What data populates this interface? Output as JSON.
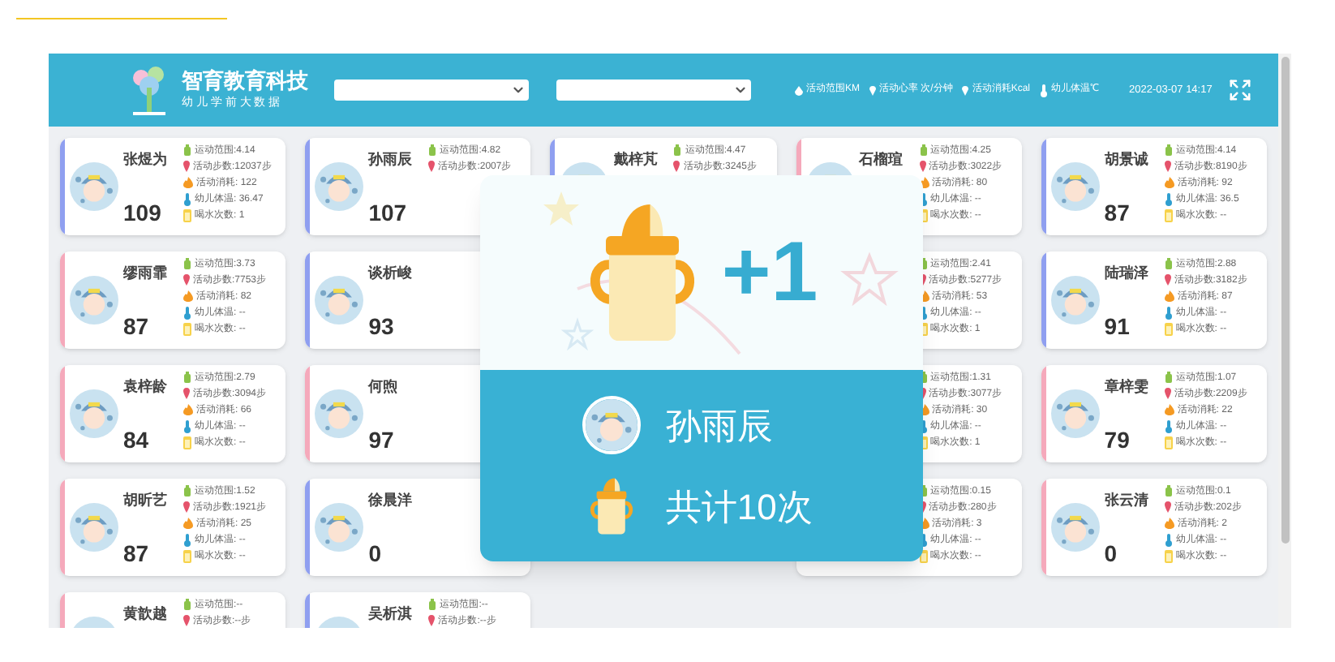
{
  "header": {
    "title": "智育教育科技",
    "subtitle": "幼 儿 学 前 大 数 据",
    "selects": [
      {
        "kind": "select"
      },
      {
        "kind": "select"
      }
    ],
    "legend": [
      {
        "kind": "drop",
        "text": "活动范围KM"
      },
      {
        "kind": "pin",
        "text": "活动心率 次/分钟"
      },
      {
        "kind": "pin",
        "text": "活动消耗Kcal"
      },
      {
        "kind": "thermo",
        "text": "幼儿体温℃"
      }
    ],
    "datetime": "2022-03-07 14:17"
  },
  "cards": [
    {
      "name": "张煜为",
      "score": "109",
      "color": "#8f9ff0",
      "stats": [
        "运动范围:4.14",
        "活动步数:12037步",
        "活动消耗: 122",
        "幼儿体温: 36.47",
        "喝水次数: 1"
      ]
    },
    {
      "name": "孙雨辰",
      "score": "107",
      "color": "#8f9ff0",
      "stats": [
        "运动范围:4.82",
        "活动步数:2007步"
      ]
    },
    {
      "name": "戴梓芃",
      "color": "#8f9ff0",
      "stats": [
        "运动范围:4.47",
        "活动步数:3245步"
      ]
    },
    {
      "name": "石榴瑄",
      "color": "#f5a9bb",
      "stats": [
        "运动范围:4.25",
        "活动步数:3022步",
        "活动消耗: 80",
        "幼儿体温: --",
        "喝水次数: --"
      ]
    },
    {
      "name": "胡景诚",
      "score": "87",
      "color": "#8f9ff0",
      "stats": [
        "运动范围:4.14",
        "活动步数:8190步",
        "活动消耗: 92",
        "幼儿体温: 36.5",
        "喝水次数: --"
      ]
    },
    {
      "name": "缪雨霏",
      "score": "87",
      "color": "#f5a9bb",
      "stats": [
        "运动范围:3.73",
        "活动步数:7753步",
        "活动消耗: 82",
        "幼儿体温: --",
        "喝水次数: --"
      ]
    },
    {
      "name": "谈析峻",
      "score": "93",
      "color": "#8f9ff0"
    },
    {
      "stats": [
        "运动范围:2.41",
        "活动步数:5277步",
        "活动消耗: 53",
        "幼儿体温: --",
        "喝水次数: 1"
      ]
    },
    {
      "name": "陆瑞泽",
      "score": "91",
      "color": "#8f9ff0",
      "stats": [
        "运动范围:2.88",
        "活动步数:3182步",
        "活动消耗: 87",
        "幼儿体温: --",
        "喝水次数: --"
      ]
    },
    {
      "name": "袁梓龄",
      "score": "84",
      "color": "#f5a9bb",
      "stats": [
        "运动范围:2.79",
        "活动步数:3094步",
        "活动消耗: 66",
        "幼儿体温: --",
        "喝水次数: --"
      ]
    },
    {
      "name": "何煦",
      "score": "97",
      "color": "#f5a9bb"
    },
    {
      "stats": [
        "运动范围:1.31",
        "活动步数:3077步",
        "活动消耗: 30",
        "幼儿体温: --",
        "喝水次数: 1"
      ]
    },
    {
      "name": "章梓雯",
      "score": "79",
      "color": "#f5a9bb",
      "stats": [
        "运动范围:1.07",
        "活动步数:2209步",
        "活动消耗: 22",
        "幼儿体温: --",
        "喝水次数: --"
      ]
    },
    {
      "name": "胡昕艺",
      "score": "87",
      "color": "#f5a9bb",
      "stats": [
        "运动范围:1.52",
        "活动步数:1921步",
        "活动消耗: 25",
        "幼儿体温: --",
        "喝水次数: --"
      ]
    },
    {
      "name": "徐晨洋",
      "score": "0",
      "color": "#8f9ff0"
    },
    {
      "stats": [
        "运动范围:0.15",
        "活动步数:280步",
        "活动消耗: 3",
        "幼儿体温: --",
        "喝水次数: --"
      ]
    },
    {
      "name": "张云清",
      "score": "0",
      "color": "#f5a9bb",
      "stats": [
        "运动范围:0.1",
        "活动步数:202步",
        "活动消耗: 2",
        "幼儿体温: --",
        "喝水次数: --"
      ]
    },
    {
      "name": "黄歆越",
      "color": "#f5a9bb",
      "stats": [
        "运动范围:--",
        "活动步数:--步"
      ]
    },
    {
      "name": "吴析淇",
      "color": "#8f9ff0",
      "stats": [
        "运动范围:--",
        "活动步数:--步"
      ]
    }
  ],
  "popup": {
    "increment": "+1",
    "name": "孙雨辰",
    "total": "共计10次"
  }
}
